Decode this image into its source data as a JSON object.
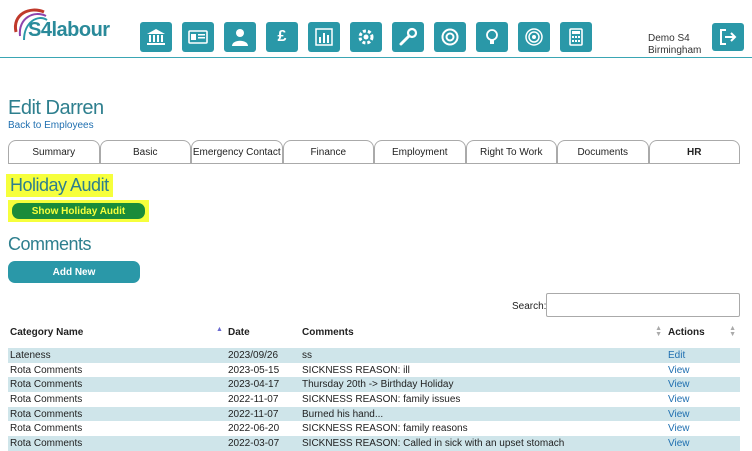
{
  "app": {
    "logo_text": "S4labour",
    "nav_icons": [
      "bank-icon",
      "id-card-icon",
      "user-icon",
      "pound-icon",
      "chart-icon",
      "gear-icon",
      "wrench-icon",
      "lifebuoy-icon",
      "lightbulb-icon",
      "target-icon",
      "calculator-icon"
    ],
    "user_name": "Demo S4",
    "user_location": "Birmingham"
  },
  "page": {
    "title": "Edit Darren",
    "back_link": "Back to Employees"
  },
  "tabs": [
    {
      "label": "Summary",
      "active": false
    },
    {
      "label": "Basic",
      "active": false
    },
    {
      "label": "Emergency Contact",
      "active": false
    },
    {
      "label": "Finance",
      "active": false
    },
    {
      "label": "Employment",
      "active": false
    },
    {
      "label": "Right To Work",
      "active": false
    },
    {
      "label": "Documents",
      "active": false
    },
    {
      "label": "HR",
      "active": true
    }
  ],
  "holiday": {
    "title": "Holiday Audit",
    "button_label": "Show Holiday Audit"
  },
  "comments": {
    "title": "Comments",
    "add_button": "Add New",
    "search_label": "Search:",
    "search_value": "",
    "columns": [
      "Category Name",
      "Date",
      "Comments",
      "Actions"
    ],
    "rows": [
      {
        "category": "Lateness",
        "date": "2023/09/26",
        "comment": "ss",
        "action": "Edit"
      },
      {
        "category": "Rota Comments",
        "date": "2023-05-15",
        "comment": "SICKNESS REASON: ill",
        "action": "View"
      },
      {
        "category": "Rota Comments",
        "date": "2023-04-17",
        "comment": "Thursday 20th -> Birthday Holiday",
        "action": "View"
      },
      {
        "category": "Rota Comments",
        "date": "2022-11-07",
        "comment": "SICKNESS REASON: family issues",
        "action": "View"
      },
      {
        "category": "Rota Comments",
        "date": "2022-11-07",
        "comment": "Burned his hand...",
        "action": "View"
      },
      {
        "category": "Rota Comments",
        "date": "2022-06-20",
        "comment": "SICKNESS REASON: family reasons",
        "action": "View"
      },
      {
        "category": "Rota Comments",
        "date": "2022-03-07",
        "comment": "SICKNESS REASON: Called in sick with an upset stomach",
        "action": "View"
      }
    ]
  },
  "colors": {
    "accent": "#2a98a8",
    "highlight": "#f6ff3c",
    "row_stripe": "#cfe5ea",
    "holiday_button": "#1a8c3a"
  }
}
